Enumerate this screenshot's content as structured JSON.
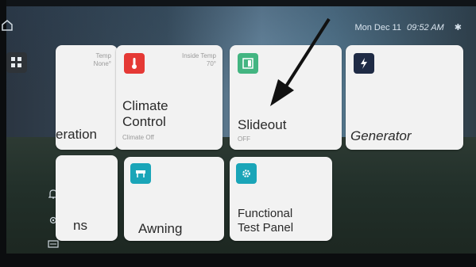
{
  "status_bar": {
    "date": "Mon Dec 11",
    "time": "09:52 AM",
    "bluetooth_icon": "bluetooth-icon"
  },
  "sidebar": {
    "home_icon": "home-icon",
    "dashboard_icon": "grid-icon",
    "notifications_icon": "bell-icon",
    "settings_icon": "gear-icon",
    "info_icon": "card-icon"
  },
  "tiles": {
    "generation": {
      "title": "eration",
      "meta_label": "Temp",
      "meta_value": "None°"
    },
    "climate": {
      "title_line1": "Climate",
      "title_line2": "Control",
      "subtitle": "Climate Off",
      "meta_label": "Inside Temp",
      "meta_value": "70°",
      "icon": "thermometer-icon",
      "icon_color": "#e53935"
    },
    "slideout": {
      "title": "Slideout",
      "subtitle": "OFF",
      "icon": "slideout-icon",
      "icon_color": "#43b581"
    },
    "generator": {
      "title": "Generator",
      "icon": "lightning-icon",
      "icon_color": "#1f2b45"
    },
    "partial_bottom": {
      "title": "ns"
    },
    "awning": {
      "title": "Awning",
      "icon": "awning-icon",
      "icon_color": "#1aa5b8"
    },
    "functional_test": {
      "title_line1": "Functional",
      "title_line2": "Test Panel",
      "icon": "gear-icon",
      "icon_color": "#1aa5b8"
    }
  }
}
